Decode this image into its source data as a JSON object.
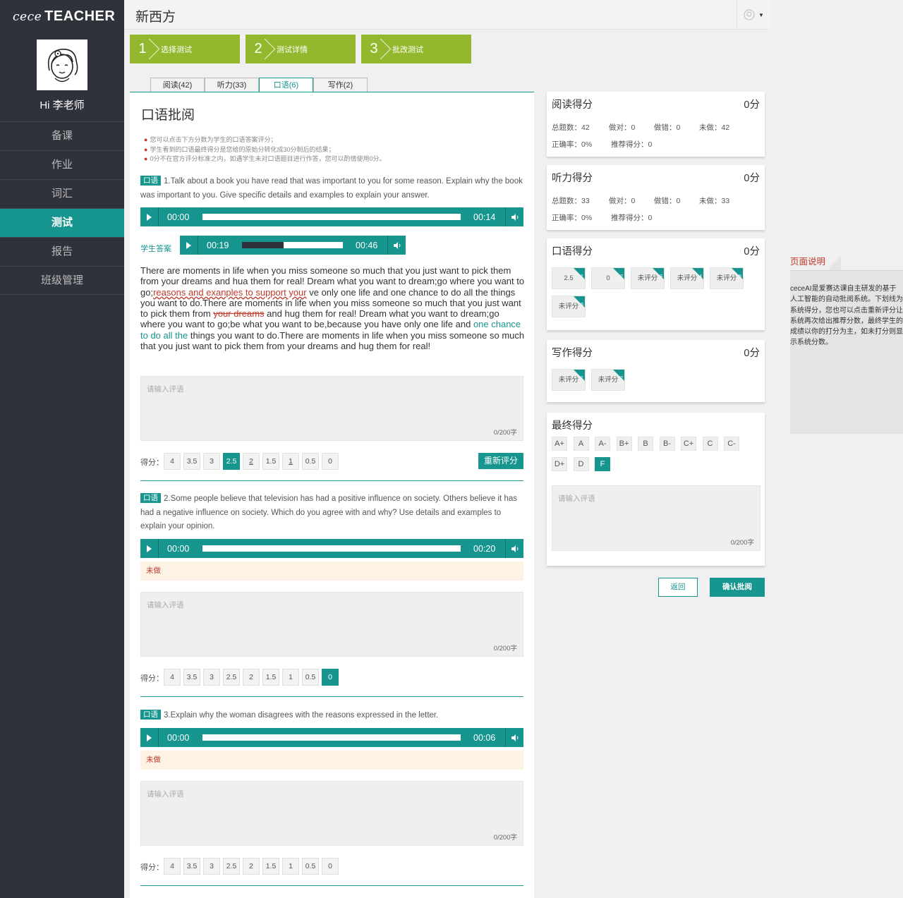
{
  "sidebar": {
    "logo_italic": "cece",
    "logo_bold": "TEACHER",
    "greeting": "Hi 李老师",
    "items": [
      {
        "label": "备课"
      },
      {
        "label": "作业"
      },
      {
        "label": "词汇"
      },
      {
        "label": "测试",
        "active": true
      },
      {
        "label": "报告"
      },
      {
        "label": "班级管理"
      }
    ]
  },
  "header": {
    "brand": "新西方"
  },
  "steps": [
    {
      "num": "1",
      "label": "选择测试"
    },
    {
      "num": "2",
      "label": "测试详情"
    },
    {
      "num": "3",
      "label": "批改测试"
    }
  ],
  "tabs": [
    {
      "label": "阅读(42)"
    },
    {
      "label": "听力(33)"
    },
    {
      "label": "口语(6)",
      "active": true
    },
    {
      "label": "写作(2)"
    }
  ],
  "main": {
    "title": "口语批阅",
    "notes": [
      "您可以点击下方分数为学生的口语答案评分；",
      "学生看到的口语最终得分是您给的原始分转化成30分制后的结果；",
      "0分不在官方评分标准之内，如遇学生未对口语题目进行作答，您可以酌情使用0分。"
    ],
    "badge": "口语",
    "student_answer_label": "学生答案",
    "comment_placeholder": "请输入评语",
    "counter": "0/200字",
    "score_label": "得分：",
    "score_options": [
      "4",
      "3.5",
      "3",
      "2.5",
      "2",
      "1.5",
      "1",
      "0.5",
      "0"
    ],
    "rescore": "重新评分",
    "undone": "未做",
    "q1": {
      "text": "1.Talk about a book you have read that was important to you for some reason. Explain why the book was important to you. Give specific details and examples to explain your answer.",
      "player": {
        "start": "00:00",
        "end": "00:14"
      },
      "student_player": {
        "start": "00:19",
        "end": "00:46",
        "progress": 0.41
      },
      "answer": {
        "p1": "There are moments in life when you miss someone so much that you just want to pick them from your dreams and hua them for real! Dream what you want to dream;go where you want to go;",
        "wavy1": "reasons and exanples to support your",
        "p2": " ve only one life and one chance to do all the things you want to do.There are moments in life when you miss someone so much that you just want to pick them from ",
        "strike1": "your dreams",
        "p3": " and hug them for real! Dream what you want to dream;go where you want to go;be what you want to be,because you have only one life and ",
        "teal1": "one chance to do all the",
        "p4": " things you want to do.There are moments in life when you miss someone so much that you just want to pick them from your dreams and hug them for real!"
      },
      "selected": "2.5",
      "underlined": [
        "2",
        "1"
      ]
    },
    "q2": {
      "text": "2.Some people believe that television has had a positive influence on society. Others believe it has had a negative influence on society. Which do you agree with and why? Use details and examples to explain your opinion.",
      "player": {
        "start": "00:00",
        "end": "00:20"
      },
      "selected": "0"
    },
    "q3": {
      "text": "3.Explain why the woman disagrees with the reasons expressed in the letter.",
      "player": {
        "start": "00:00",
        "end": "00:06"
      }
    }
  },
  "right": {
    "reading": {
      "title": "阅读得分",
      "score": "0分",
      "stats": [
        "总题数：42",
        "做对：0",
        "做错：0",
        "未做：42",
        "正确率：0%",
        "推荐得分：0"
      ]
    },
    "listening": {
      "title": "听力得分",
      "score": "0分",
      "stats": [
        "总题数：33",
        "做对：0",
        "做错：0",
        "未做：33",
        "正确率：0%",
        "推荐得分：0"
      ]
    },
    "speaking": {
      "title": "口语得分",
      "score": "0分",
      "chips": [
        {
          "value": "2.5",
          "num": "1"
        },
        {
          "value": "0",
          "num": "2"
        },
        {
          "value": "未评分",
          "num": "3"
        },
        {
          "value": "未评分",
          "num": "4"
        },
        {
          "value": "未评分",
          "num": "5"
        },
        {
          "value": "未评分",
          "num": "6"
        }
      ]
    },
    "writing": {
      "title": "写作得分",
      "score": "0分",
      "chips": [
        {
          "value": "未评分",
          "num": "1"
        },
        {
          "value": "未评分",
          "num": "2"
        }
      ]
    },
    "final": {
      "title": "最终得分",
      "grades": [
        "A+",
        "A",
        "A-",
        "B+",
        "B",
        "B-",
        "C+",
        "C",
        "C-",
        "D+",
        "D",
        "F"
      ],
      "selected": "F",
      "placeholder": "请输入评语",
      "counter": "0/200字"
    },
    "back": "返回",
    "confirm": "确认批阅"
  },
  "help": {
    "title": "页面说明",
    "text": "ceceAI是爱赛达课自主研发的基于人工智能的自动批阅系统。下划线为系统得分，您也可以点击重新评分让系统再次给出推荐分数，最终学生的成绩以你的打分为主，如未打分则显示系统分数。"
  },
  "colors": {
    "accent": "#17958f",
    "step": "#94b82d",
    "sidebar": "#30323b",
    "alert": "#c0392b"
  }
}
